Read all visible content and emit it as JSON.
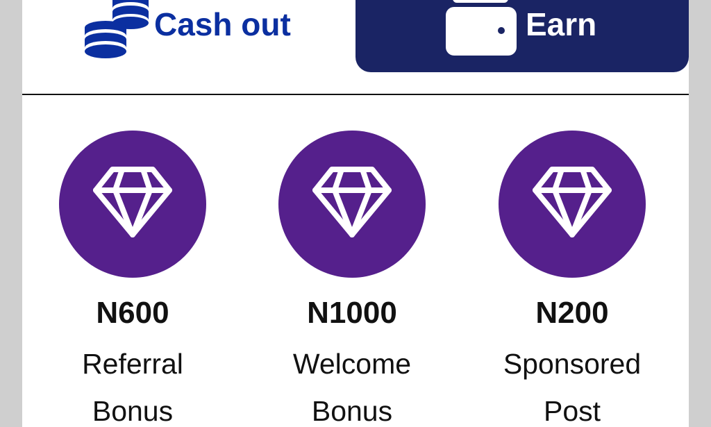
{
  "header": {
    "cashout": {
      "label": "Cash out",
      "icon": "coins-icon"
    },
    "earn": {
      "label": "Earn",
      "icon": "wallet-icon"
    }
  },
  "bonuses": [
    {
      "amount": "N600",
      "line1": "Referral",
      "line2": "Bonus",
      "icon": "diamond-icon"
    },
    {
      "amount": "N1000",
      "line1": "Welcome",
      "line2": "Bonus",
      "icon": "diamond-icon"
    },
    {
      "amount": "N200",
      "line1": "Sponsored",
      "line2": "Post",
      "icon": "diamond-icon"
    }
  ],
  "colors": {
    "page_background": "#cfcfcf",
    "card_background": "#ffffff",
    "cashout_text": "#0b2fa0",
    "earn_button": "#1a2464",
    "bonus_circle": "#55208c",
    "text": "#111111"
  }
}
